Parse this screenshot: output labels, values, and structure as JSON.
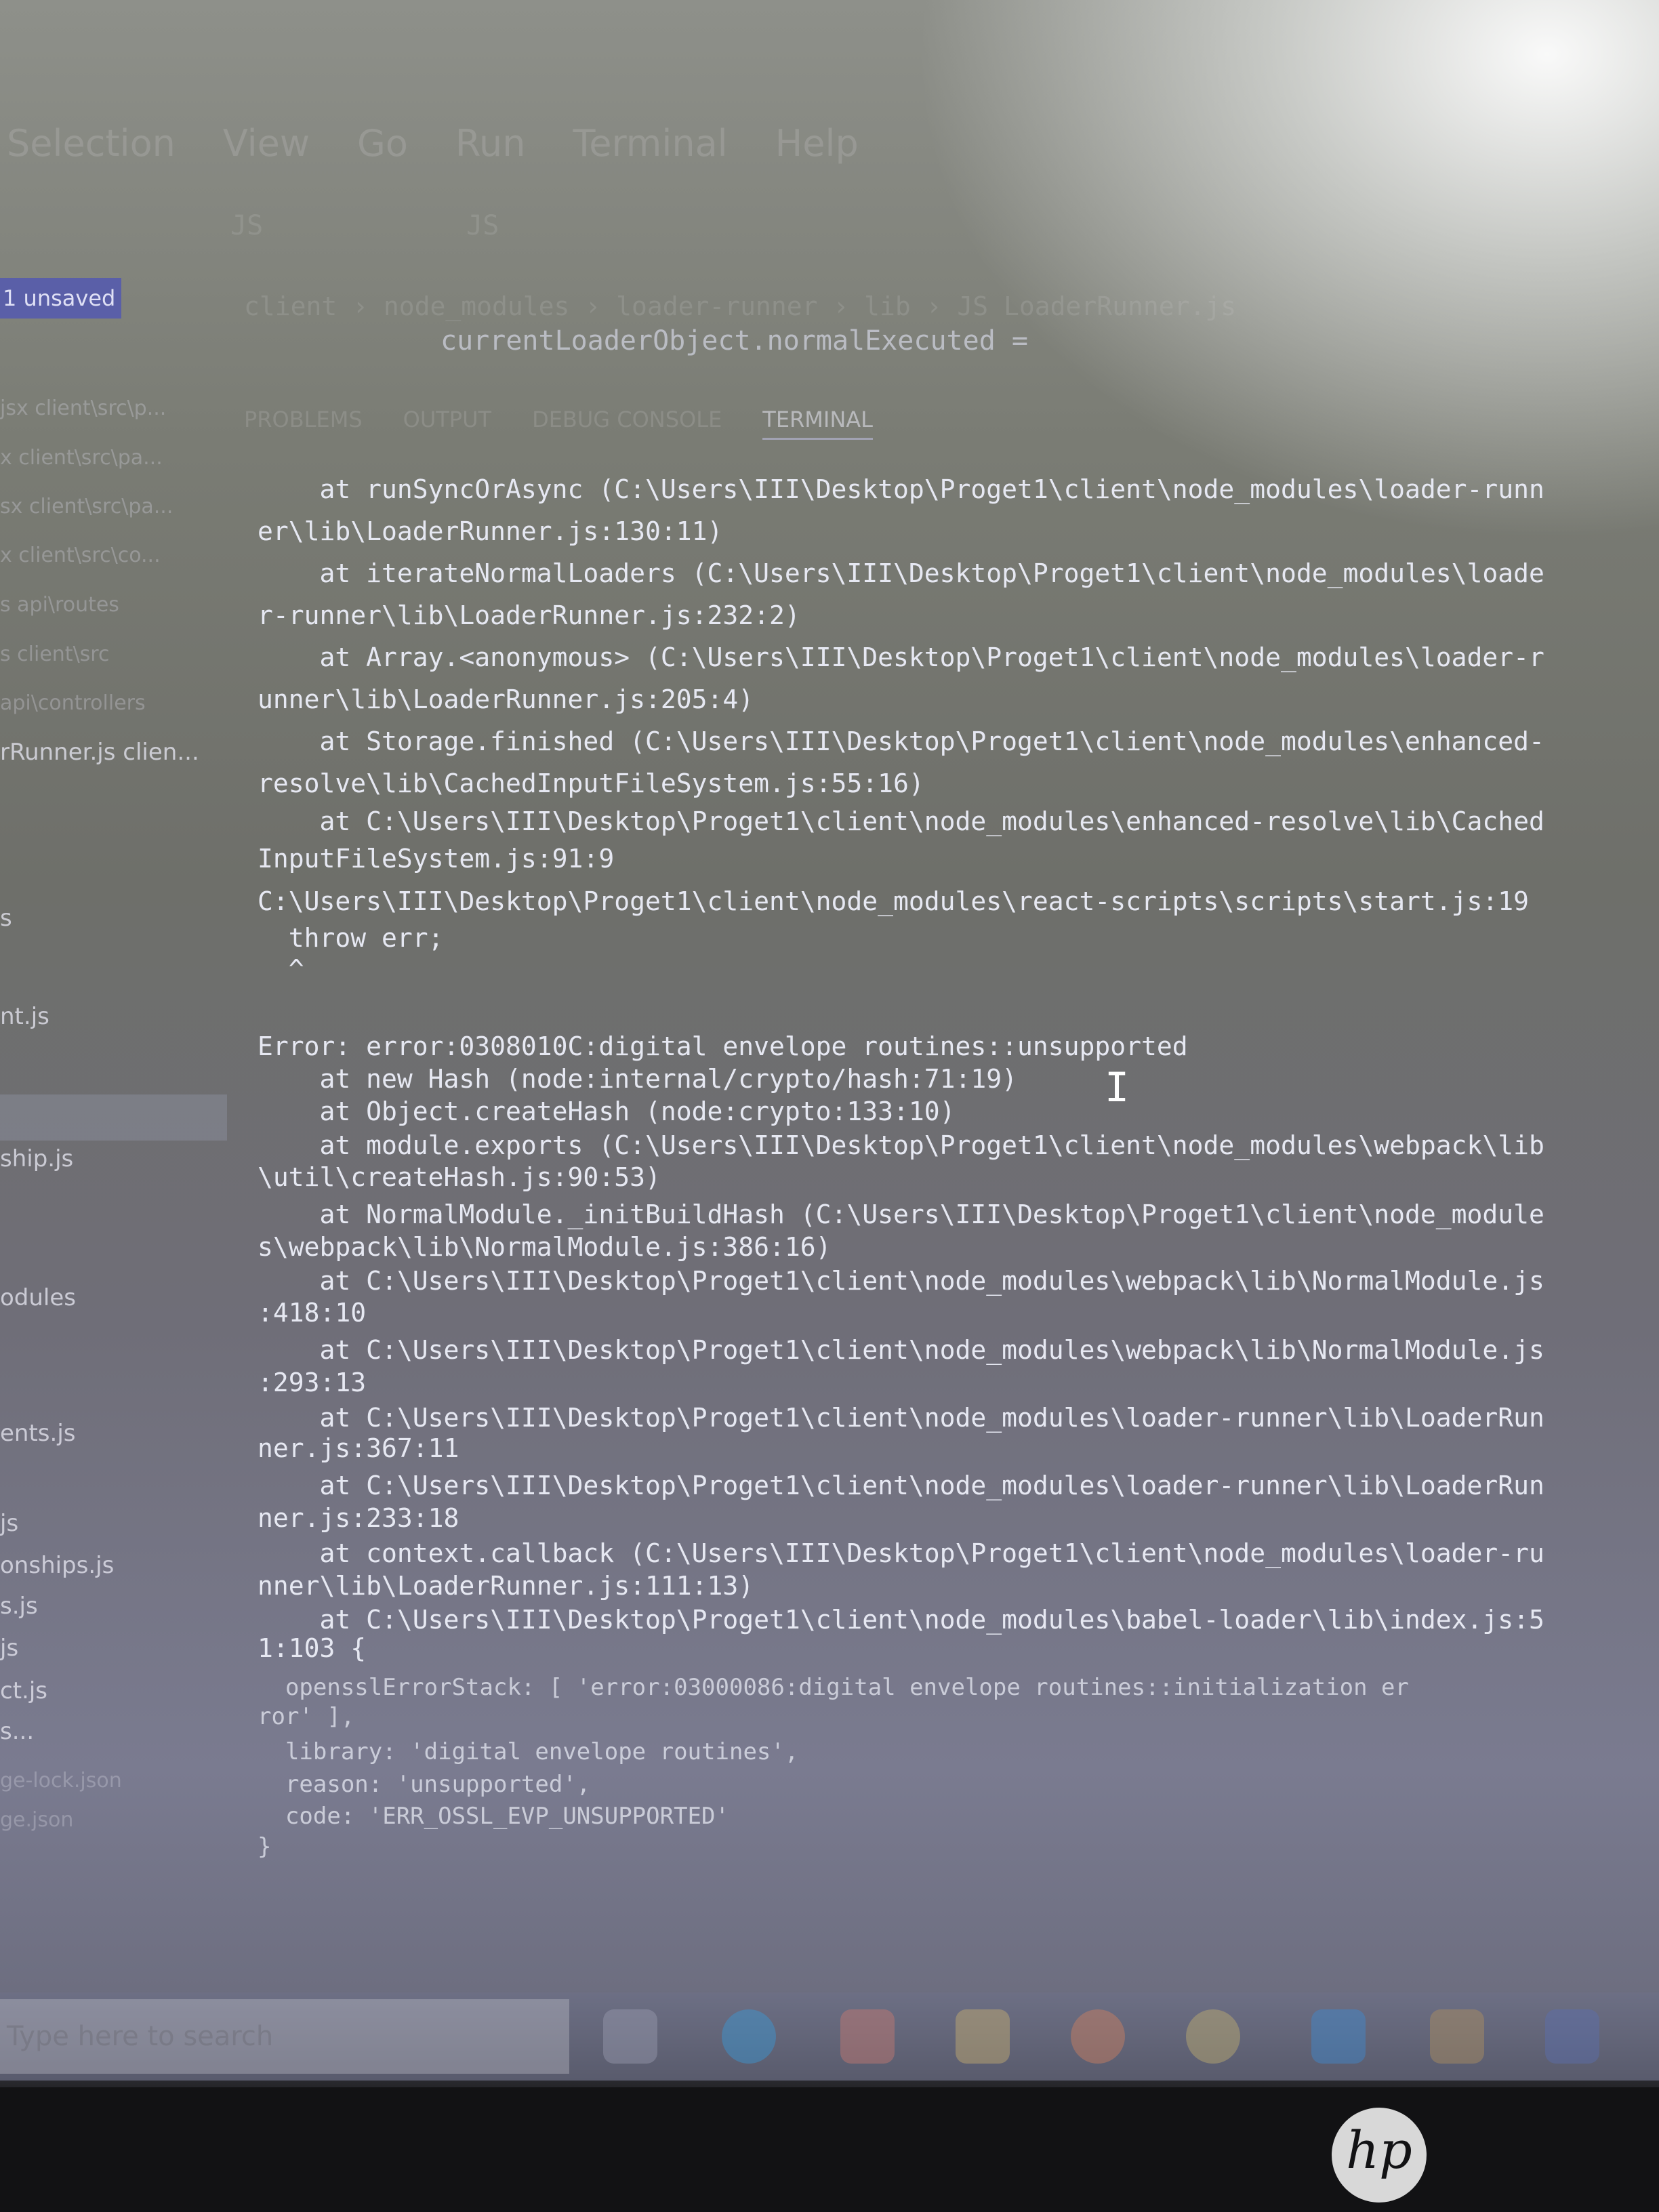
{
  "menubar": {
    "items": [
      "Selection",
      "View",
      "Go",
      "Run",
      "Terminal",
      "Help"
    ]
  },
  "editor": {
    "tabs": [
      "JS",
      "JS"
    ],
    "breadcrumb": "client › node_modules › loader-runner › lib › JS LoaderRunner.js",
    "code_line": "currentLoaderObject.normalExecuted ="
  },
  "panel": {
    "tabs": [
      "PROBLEMS",
      "OUTPUT",
      "DEBUG CONSOLE",
      "TERMINAL"
    ],
    "active": "TERMINAL"
  },
  "sidebar": {
    "unsaved_badge": "1 unsaved",
    "open_editors": [
      "jsx client\\src\\p...",
      "x client\\src\\pa...",
      "sx client\\src\\pa...",
      "x client\\src\\co...",
      "s api\\routes",
      "s client\\src",
      "api\\controllers",
      "rRunner.js clien..."
    ],
    "files": [
      "s",
      "nt.js",
      "ship.js",
      "odules",
      "ents.js",
      "js",
      "onships.js",
      "s.js",
      "js",
      "ct.js",
      "s...",
      "ge-lock.json",
      "ge.json"
    ]
  },
  "terminal": {
    "lines": [
      "    at runSyncOrAsync (C:\\Users\\III\\Desktop\\Proget1\\client\\node_modules\\loader-runn",
      "er\\lib\\LoaderRunner.js:130:11)",
      "    at iterateNormalLoaders (C:\\Users\\III\\Desktop\\Proget1\\client\\node_modules\\loade",
      "r-runner\\lib\\LoaderRunner.js:232:2)",
      "    at Array.<anonymous> (C:\\Users\\III\\Desktop\\Proget1\\client\\node_modules\\loader-r",
      "unner\\lib\\LoaderRunner.js:205:4)",
      "    at Storage.finished (C:\\Users\\III\\Desktop\\Proget1\\client\\node_modules\\enhanced-",
      "resolve\\lib\\CachedInputFileSystem.js:55:16)",
      "    at C:\\Users\\III\\Desktop\\Proget1\\client\\node_modules\\enhanced-resolve\\lib\\Cached",
      "InputFileSystem.js:91:9",
      "C:\\Users\\III\\Desktop\\Proget1\\client\\node_modules\\react-scripts\\scripts\\start.js:19",
      "  throw err;",
      "  ^",
      "",
      "Error: error:0308010C:digital envelope routines::unsupported",
      "    at new Hash (node:internal/crypto/hash:71:19)",
      "    at Object.createHash (node:crypto:133:10)",
      "    at module.exports (C:\\Users\\III\\Desktop\\Proget1\\client\\node_modules\\webpack\\lib",
      "\\util\\createHash.js:90:53)",
      "    at NormalModule._initBuildHash (C:\\Users\\III\\Desktop\\Proget1\\client\\node_module",
      "s\\webpack\\lib\\NormalModule.js:386:16)",
      "    at C:\\Users\\III\\Desktop\\Proget1\\client\\node_modules\\webpack\\lib\\NormalModule.js",
      ":418:10",
      "    at C:\\Users\\III\\Desktop\\Proget1\\client\\node_modules\\webpack\\lib\\NormalModule.js",
      ":293:13",
      "    at C:\\Users\\III\\Desktop\\Proget1\\client\\node_modules\\loader-runner\\lib\\LoaderRun",
      "ner.js:367:11",
      "    at C:\\Users\\III\\Desktop\\Proget1\\client\\node_modules\\loader-runner\\lib\\LoaderRun",
      "ner.js:233:18",
      "    at context.callback (C:\\Users\\III\\Desktop\\Proget1\\client\\node_modules\\loader-ru",
      "nner\\lib\\LoaderRunner.js:111:13)",
      "    at C:\\Users\\III\\Desktop\\Proget1\\client\\node_modules\\babel-loader\\lib\\index.js:5",
      "1:103 {",
      "  opensslErrorStack: [ 'error:03000086:digital envelope routines::initialization er",
      "ror' ],",
      "  library: 'digital envelope routines',",
      "  reason: 'unsupported',",
      "  code: 'ERR_OSSL_EVP_UNSUPPORTED'",
      "}"
    ]
  },
  "taskbar": {
    "search_placeholder": "Type here to search",
    "icons": [
      "task-view-icon",
      "edge-icon",
      "brave-icon",
      "file-explorer-icon",
      "firefox-icon",
      "chrome-icon",
      "vscode-icon",
      "app-icon",
      "app-icon-2"
    ]
  },
  "bezel": {
    "logo": "hp"
  }
}
